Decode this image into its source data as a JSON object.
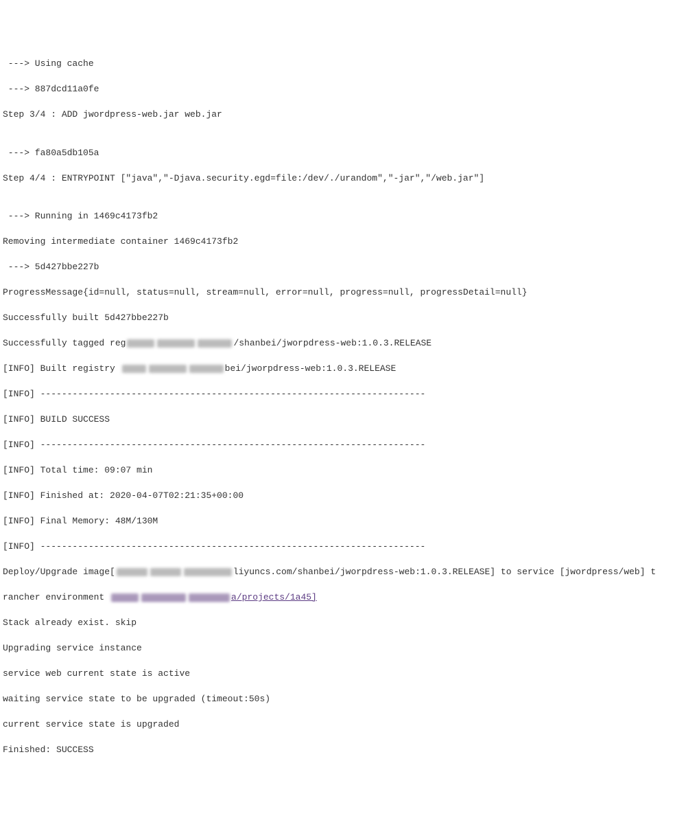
{
  "lines": {
    "l0": " ---> Using cache",
    "l1": " ---> 887dcd11a0fe",
    "l2": "Step 3/4 : ADD jwordpress-web.jar web.jar",
    "l3": "",
    "l4": " ---> fa80a5db105a",
    "l5": "Step 4/4 : ENTRYPOINT [\"java\",\"-Djava.security.egd=file:/dev/./urandom\",\"-jar\",\"/web.jar\"]",
    "l6": "",
    "l7": " ---> Running in 1469c4173fb2",
    "l8": "Removing intermediate container 1469c4173fb2",
    "l9": " ---> 5d427bbe227b",
    "l10": "ProgressMessage{id=null, status=null, stream=null, error=null, progress=null, progressDetail=null}",
    "l11": "Successfully built 5d427bbe227b",
    "l12a": "Successfully tagged reg",
    "l12b": "/shanbei/jworpdress-web:1.0.3.RELEASE",
    "l13a": "[INFO] Built registry ",
    "l13b": "bei/jworpdress-web:1.0.3.RELEASE",
    "l14": "[INFO] ------------------------------------------------------------------------",
    "l15": "[INFO] BUILD SUCCESS",
    "l16": "[INFO] ------------------------------------------------------------------------",
    "l17": "[INFO] Total time: 09:07 min",
    "l18": "[INFO] Finished at: 2020-04-07T02:21:35+00:00",
    "l19": "[INFO] Final Memory: 48M/130M",
    "l20": "[INFO] ------------------------------------------------------------------------",
    "l21a": "Deploy/Upgrade image[",
    "l21b": "liyuncs.com/shanbei/jworpdress-web:1.0.3.RELEASE] to service [jwordpress/web] t",
    "l22a": "rancher environment ",
    "l22b": "a/projects/1a45]",
    "l23": "Stack already exist. skip",
    "l24": "Upgrading service instance",
    "l25": "service web current state is active",
    "l26": "waiting service state to be upgraded (timeout:50s)",
    "l27": "current service state is upgraded",
    "l28": "Finished: SUCCESS"
  }
}
